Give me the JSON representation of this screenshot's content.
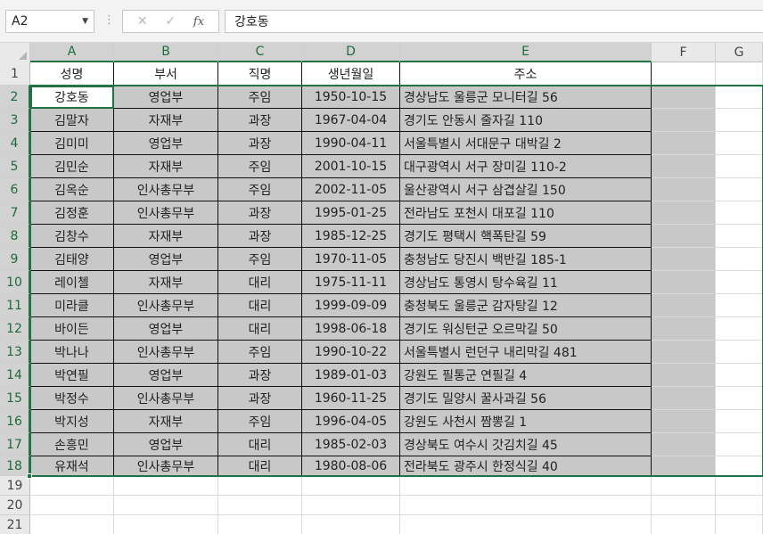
{
  "formula_bar": {
    "name_box": "A2",
    "name_box_arrow": "▼",
    "separator": "⋮",
    "cancel_icon": "✕",
    "enter_icon": "✓",
    "fx_label": "fx",
    "formula_value": "강호동"
  },
  "columns": [
    "A",
    "B",
    "C",
    "D",
    "E",
    "F",
    "G"
  ],
  "row_numbers": [
    "1",
    "2",
    "3",
    "4",
    "5",
    "6",
    "7",
    "8",
    "9",
    "10",
    "11",
    "12",
    "13",
    "14",
    "15",
    "16",
    "17",
    "18",
    "19",
    "20",
    "21"
  ],
  "header_row": [
    "성명",
    "부서",
    "직명",
    "생년월일",
    "주소"
  ],
  "rows": [
    [
      "강호동",
      "영업부",
      "주임",
      "1950-10-15",
      "경상남도 울릉군 모니터길 56"
    ],
    [
      "김말자",
      "자재부",
      "과장",
      "1967-04-04",
      "경기도 안동시 줄자길 110"
    ],
    [
      "김미미",
      "영업부",
      "과장",
      "1990-04-11",
      "서울특별시 서대문구 대박길 2"
    ],
    [
      "김민순",
      "자재부",
      "주임",
      "2001-10-15",
      "대구광역시 서구 장미길 110-2"
    ],
    [
      "김옥순",
      "인사총무부",
      "주임",
      "2002-11-05",
      "울산광역시 서구 삼겹살길 150"
    ],
    [
      "김정훈",
      "인사총무부",
      "과장",
      "1995-01-25",
      "전라남도 포천시 대포길 110"
    ],
    [
      "김창수",
      "자재부",
      "과장",
      "1985-12-25",
      "경기도 평택시 핵폭탄길 59"
    ],
    [
      "김태양",
      "영업부",
      "주임",
      "1970-11-05",
      "충청남도 당진시 백반길 185-1"
    ],
    [
      "레이첼",
      "자재부",
      "대리",
      "1975-11-11",
      "경상남도 통영시 탕수육길 11"
    ],
    [
      "미라클",
      "인사총무부",
      "대리",
      "1999-09-09",
      "충청북도 울릉군 감자탕길 12"
    ],
    [
      "바이든",
      "영업부",
      "대리",
      "1998-06-18",
      "경기도 워싱턴군 오르막길 50"
    ],
    [
      "박나나",
      "인사총무부",
      "주임",
      "1990-10-22",
      "서울특별시 런던구 내리막길 481"
    ],
    [
      "박연필",
      "영업부",
      "과장",
      "1989-01-03",
      "강원도 필통군 연필길 4"
    ],
    [
      "박정수",
      "인사총무부",
      "과장",
      "1960-11-25",
      "경기도 밀양시 꿀사과길 56"
    ],
    [
      "박지성",
      "자재부",
      "주임",
      "1996-04-05",
      "강원도 사천시 짬뽕길 1"
    ],
    [
      "손흥민",
      "영업부",
      "대리",
      "1985-02-03",
      "경상북도 여수시 갓김치길 45"
    ],
    [
      "유재석",
      "인사총무부",
      "대리",
      "1980-08-06",
      "전라북도 광주시 한정식길 40"
    ]
  ],
  "colors": {
    "selection": "#217346",
    "selected_fill": "#c8c8c8",
    "header_bg": "#e9e9e9"
  }
}
